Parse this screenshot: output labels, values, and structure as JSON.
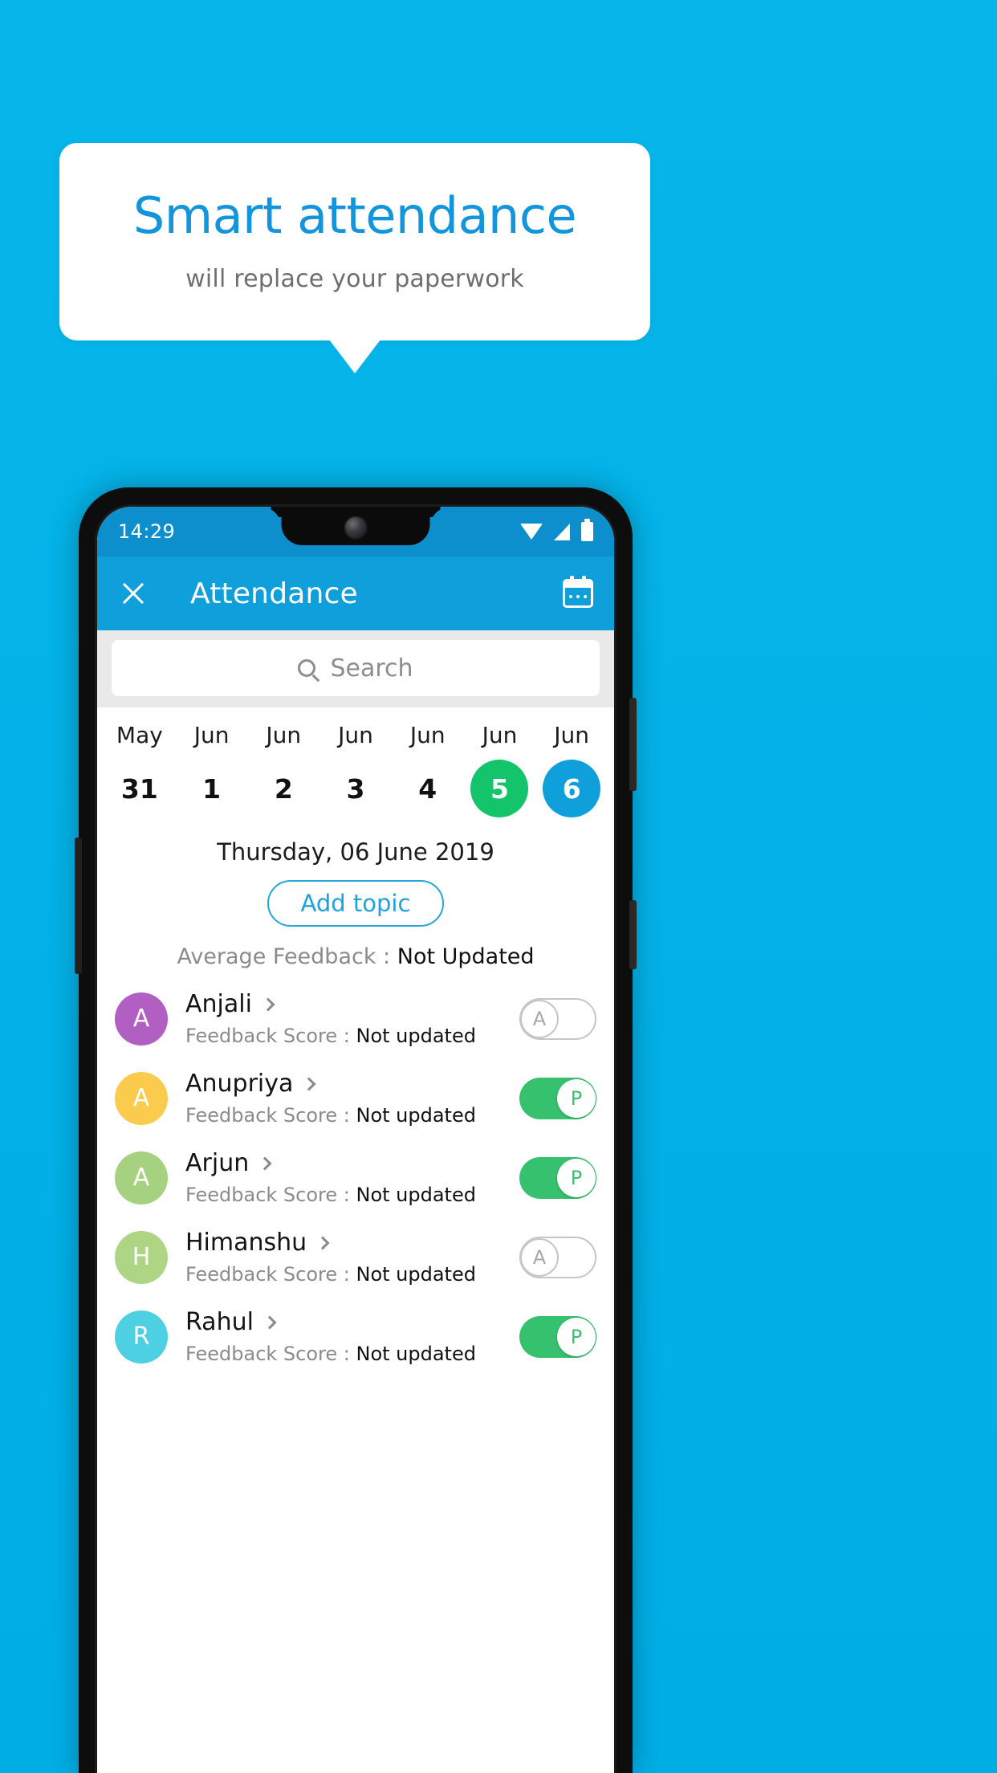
{
  "promo": {
    "title": "Smart attendance",
    "subtitle": "will replace your paperwork",
    "title_color": "#1295dd",
    "background_color": "#04b4e8"
  },
  "phone": {
    "statusbar": {
      "time": "14:29",
      "icons": [
        "wifi-icon",
        "signal-icon",
        "battery-icon"
      ]
    },
    "appbar": {
      "close_icon": "close-icon",
      "title": "Attendance",
      "calendar_icon": "calendar-icon",
      "color": "#0f9fdb"
    },
    "search": {
      "placeholder": "Search",
      "value": "",
      "icon": "search-icon"
    },
    "date_strip": [
      {
        "month": "May",
        "day": "31",
        "state": "normal"
      },
      {
        "month": "Jun",
        "day": "1",
        "state": "normal"
      },
      {
        "month": "Jun",
        "day": "2",
        "state": "normal"
      },
      {
        "month": "Jun",
        "day": "3",
        "state": "normal"
      },
      {
        "month": "Jun",
        "day": "4",
        "state": "normal"
      },
      {
        "month": "Jun",
        "day": "5",
        "state": "green"
      },
      {
        "month": "Jun",
        "day": "6",
        "state": "blue"
      }
    ],
    "selected_day_label": "Thursday, 06 June 2019",
    "add_topic_label": "Add topic",
    "average_feedback": {
      "label": "Average Feedback : ",
      "value": "Not Updated"
    },
    "score_label": "Feedback Score : ",
    "students": [
      {
        "name": "Anjali",
        "initial": "A",
        "avatar_color": "#b25fc4",
        "score": "Not updated",
        "attendance": "A",
        "state": "absent"
      },
      {
        "name": "Anupriya",
        "initial": "A",
        "avatar_color": "#fbcb4e",
        "score": "Not updated",
        "attendance": "P",
        "state": "present"
      },
      {
        "name": "Arjun",
        "initial": "A",
        "avatar_color": "#a6d181",
        "score": "Not updated",
        "attendance": "P",
        "state": "present"
      },
      {
        "name": "Himanshu",
        "initial": "H",
        "avatar_color": "#aed584",
        "score": "Not updated",
        "attendance": "A",
        "state": "absent"
      },
      {
        "name": "Rahul",
        "initial": "R",
        "avatar_color": "#4dd0e1",
        "score": "Not updated",
        "attendance": "P",
        "state": "present"
      }
    ]
  },
  "colors": {
    "accent_blue": "#0f9fdb",
    "present_green": "#35c16e",
    "selected_green": "#13c46a",
    "absent_gray": "#c6c6c6"
  }
}
